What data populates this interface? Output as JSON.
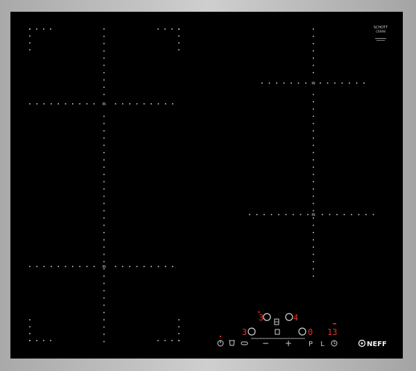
{
  "brand": {
    "glass_maker_line1": "SCHOTT",
    "glass_maker_line2": "CERAN",
    "logo_text": "NEFF"
  },
  "colors": {
    "glass": "#000000",
    "frame": "#b9b9b9",
    "display_red": "#e2322a",
    "marking": "#d8d8d8"
  },
  "zone_marker": "IN",
  "controls": {
    "top_left_level": "3",
    "top_right_level": "4",
    "bottom_left_level": "3",
    "bottom_mid_level": "0",
    "timer_value": "13",
    "power_icon": "power-icon",
    "cookingsensor_icon": "frying-sensor-icon",
    "flex_icon": "flexinduction-icon",
    "minus_symbol": "−",
    "plus_symbol": "+",
    "powerboost_symbol": "P",
    "lock_symbol": "L",
    "timer_icon": "clock-icon"
  }
}
